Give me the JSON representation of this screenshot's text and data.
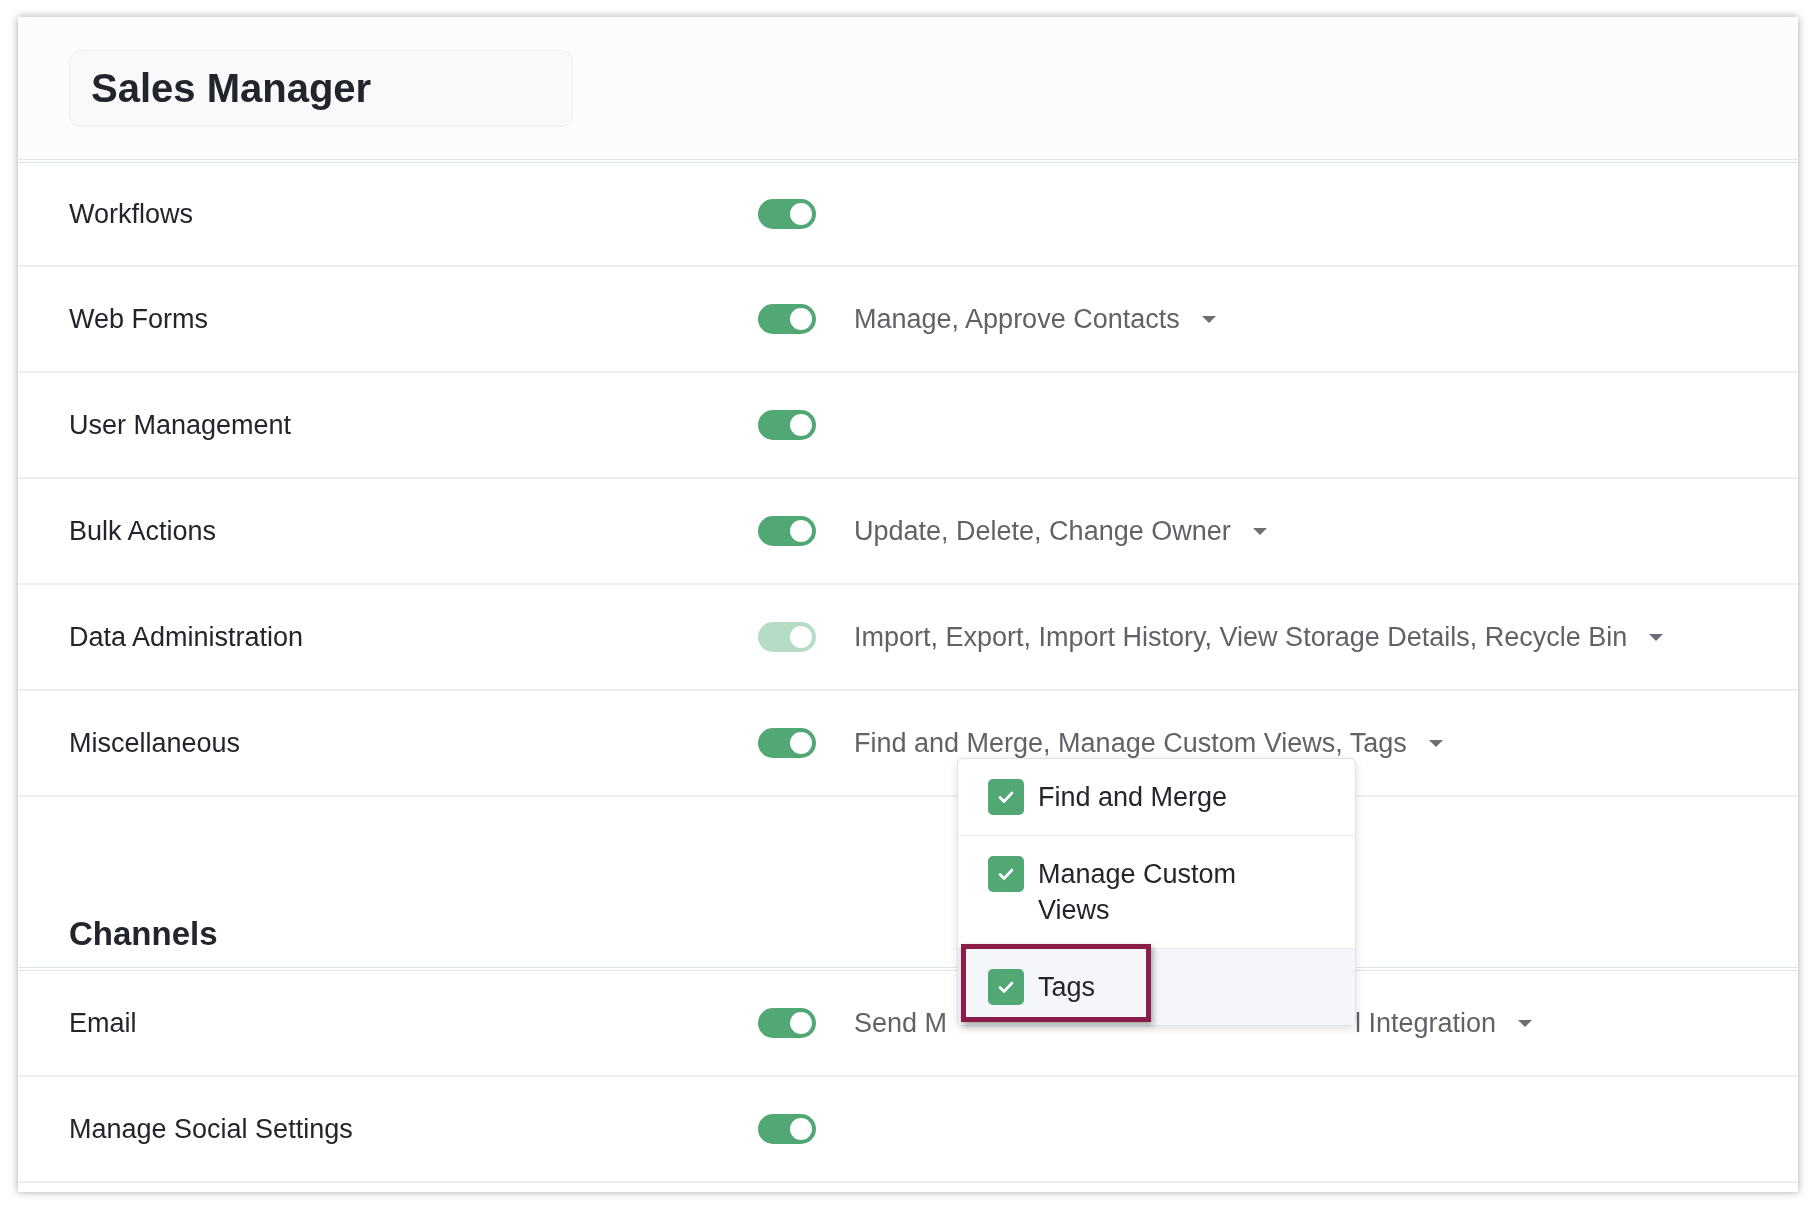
{
  "title": "Sales Manager",
  "permissions": [
    {
      "label": "Workflows",
      "on": true,
      "disabled": false
    },
    {
      "label": "Web Forms",
      "on": true,
      "disabled": false,
      "summary": "Manage, Approve Contacts"
    },
    {
      "label": "User Management",
      "on": true,
      "disabled": false
    },
    {
      "label": "Bulk Actions",
      "on": true,
      "disabled": false,
      "summary": "Update, Delete, Change Owner"
    },
    {
      "label": "Data Administration",
      "on": true,
      "disabled": true,
      "summary": "Import, Export, Import History, View Storage Details, Recycle Bin"
    },
    {
      "label": "Miscellaneous",
      "on": true,
      "disabled": false,
      "summary": "Find and Merge, Manage Custom Views, Tags",
      "dropdown": {
        "items": [
          {
            "label": "Find and Merge",
            "checked": true,
            "highlighted": false
          },
          {
            "label": "Manage Custom Views",
            "checked": true,
            "highlighted": false
          },
          {
            "label": "Tags",
            "checked": true,
            "highlighted": true
          }
        ]
      }
    }
  ],
  "channels": {
    "heading": "Channels",
    "items": [
      {
        "label": "Email",
        "on": true,
        "disabled": false,
        "summary": "Send M",
        "summary_tail": "l Integration"
      },
      {
        "label": "Manage Social Settings",
        "on": true,
        "disabled": false
      }
    ]
  }
}
